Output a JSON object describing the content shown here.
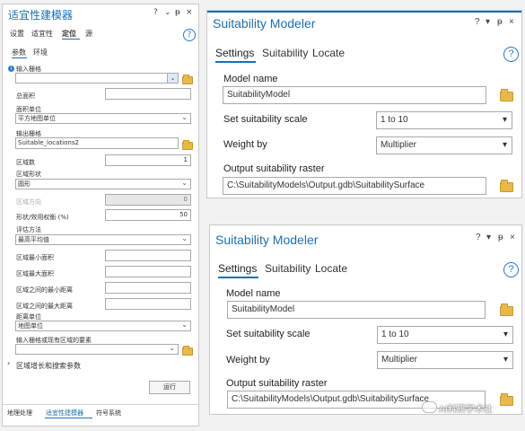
{
  "left": {
    "title": "适宜性建模器",
    "window_controls": [
      "?",
      "⌄",
      "ᵽ",
      "×"
    ],
    "tabs": [
      "设置",
      "适宜性",
      "定位",
      "源"
    ],
    "subtabs": [
      "参数",
      "环境"
    ],
    "fields": {
      "input_raster_label": "输入栅格",
      "total_area_label": "总面积",
      "area_units_label": "面积单位",
      "area_units_value": "平方地图单位",
      "output_raster_label": "输出栅格",
      "output_raster_value": "Suitable_locations2",
      "region_count_label": "区域数",
      "region_count_value": "1",
      "region_shape_label": "区域形状",
      "region_shape_value": "圆形",
      "region_orientation_label": "区域方向",
      "region_orientation_value": "0",
      "shape_weight_label": "形状/效用权衡 (%)",
      "shape_weight_value": "50",
      "eval_method_label": "评估方法",
      "eval_method_value": "最高平均值",
      "min_area_label": "区域最小面积",
      "max_area_label": "区域最大面积",
      "min_dist_label": "区域之间的最小距离",
      "max_dist_label": "区域之间的最大距离",
      "dist_units_label": "距离单位",
      "dist_units_value": "地图单位",
      "existing_label": "输入栅格或现有区域的要素",
      "growth_section": "区域增长和搜索参数"
    },
    "run_button": "运行",
    "bottom_tabs": [
      "地理处理",
      "适宜性建模器",
      "符号系统"
    ]
  },
  "dialogs": [
    {
      "title": "Suitability Modeler",
      "controls": [
        "?",
        "▾",
        "ᵽ",
        "×"
      ],
      "tabs": [
        "Settings",
        "Suitability",
        "Locate"
      ],
      "model_name_label": "Model name",
      "model_name_value": "SuitabilityModel",
      "scale_label": "Set suitability scale",
      "scale_value": "1 to 10",
      "weight_label": "Weight by",
      "weight_value": "Multiplier",
      "output_label": "Output suitability raster",
      "output_value": "C:\\SuitabilityModels\\Output.gdb\\SuitabilitySurface"
    },
    {
      "title": "Suitability Modeler",
      "controls": [
        "?",
        "▾",
        "ᵽ",
        "×"
      ],
      "tabs": [
        "Settings",
        "Suitability",
        "Locate"
      ],
      "model_name_label": "Model name",
      "model_name_value": "SuitabilityModel",
      "scale_label": "Set suitability scale",
      "scale_value": "1 to 10",
      "weight_label": "Weight by",
      "weight_value": "Multiplier",
      "output_label": "Output suitability raster",
      "output_value": "C:\\SuitabilityModels\\Output.gdb\\SuitabilitySurface"
    }
  ],
  "watermark": "AI科研学术社",
  "colors": {
    "accent": "#1a6fb3",
    "folder": "#e8b84a"
  }
}
